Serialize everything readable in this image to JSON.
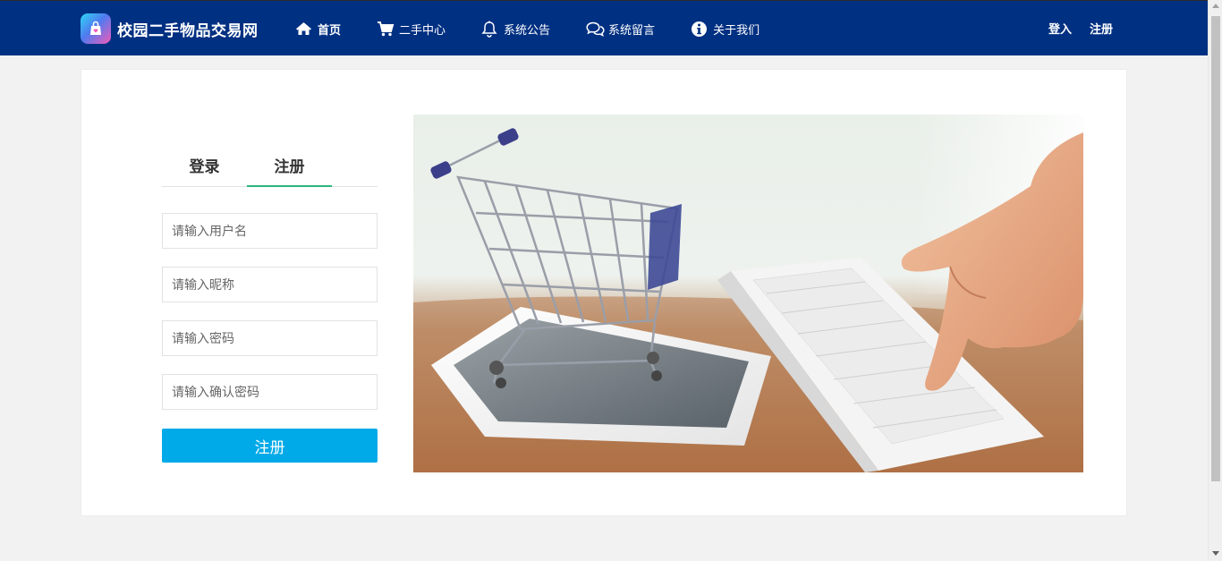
{
  "site": {
    "name": "校园二手物品交易网"
  },
  "nav": {
    "items": [
      {
        "label": "首页",
        "icon": "home-icon"
      },
      {
        "label": "二手中心",
        "icon": "cart-icon"
      },
      {
        "label": "系统公告",
        "icon": "bell-icon"
      },
      {
        "label": "系统留言",
        "icon": "comments-icon"
      },
      {
        "label": "关于我们",
        "icon": "info-icon"
      }
    ],
    "active_index": 0,
    "login": "登入",
    "register": "注册"
  },
  "form": {
    "tabs": [
      {
        "label": "登录"
      },
      {
        "label": "注册"
      }
    ],
    "active_tab": 1,
    "fields": [
      {
        "placeholder": "请输入用户名",
        "value": ""
      },
      {
        "placeholder": "请输入昵称",
        "value": ""
      },
      {
        "placeholder": "请输入密码",
        "value": ""
      },
      {
        "placeholder": "请输入确认密码",
        "value": ""
      }
    ],
    "submit_label": "注册"
  },
  "colors": {
    "nav_bg": "#003082",
    "accent_tab": "#2ab57d",
    "button": "#00a9e8",
    "page_bg": "#f2f2f2"
  }
}
